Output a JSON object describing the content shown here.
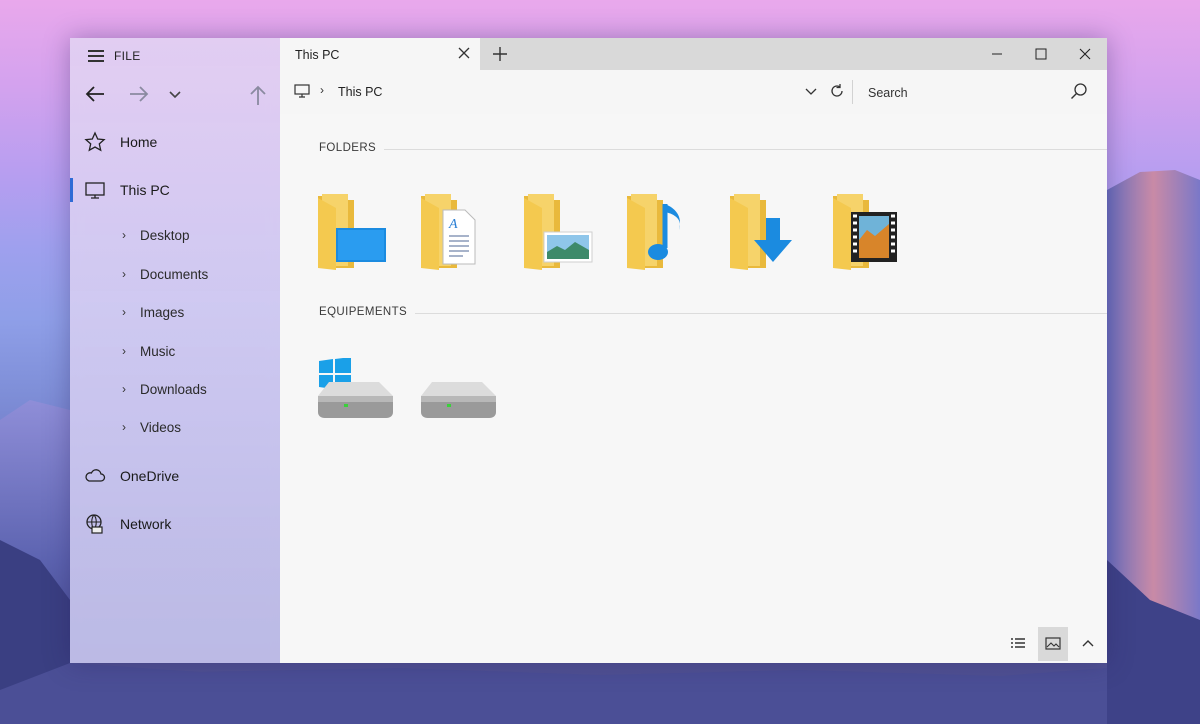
{
  "sidebar": {
    "menu_label": "FILE",
    "items": [
      {
        "label": "Home",
        "icon": "star-icon"
      },
      {
        "label": "This PC",
        "icon": "computer-icon",
        "active": true
      },
      {
        "label": "OneDrive",
        "icon": "cloud-icon"
      },
      {
        "label": "Network",
        "icon": "network-icon"
      }
    ],
    "subitems": [
      {
        "label": "Desktop"
      },
      {
        "label": "Documents"
      },
      {
        "label": "Images"
      },
      {
        "label": "Music"
      },
      {
        "label": "Downloads"
      },
      {
        "label": "Videos"
      }
    ]
  },
  "tab": {
    "label": "This PC"
  },
  "address": {
    "crumb": "This PC"
  },
  "search": {
    "placeholder": "Search"
  },
  "sections": {
    "folders": "FOLDERS",
    "devices": "EQUIPEMENTS"
  },
  "folders": [
    {
      "icon": "desktop-folder-icon"
    },
    {
      "icon": "documents-folder-icon"
    },
    {
      "icon": "images-folder-icon"
    },
    {
      "icon": "music-folder-icon"
    },
    {
      "icon": "downloads-folder-icon"
    },
    {
      "icon": "videos-folder-icon"
    }
  ],
  "devices": [
    {
      "icon": "windows-drive-icon"
    },
    {
      "icon": "drive-icon"
    }
  ],
  "colors": {
    "accent": "#2f6bd6",
    "folder": "#f6d36a",
    "folder_dark": "#e9b93c",
    "blue": "#1b8be0"
  }
}
